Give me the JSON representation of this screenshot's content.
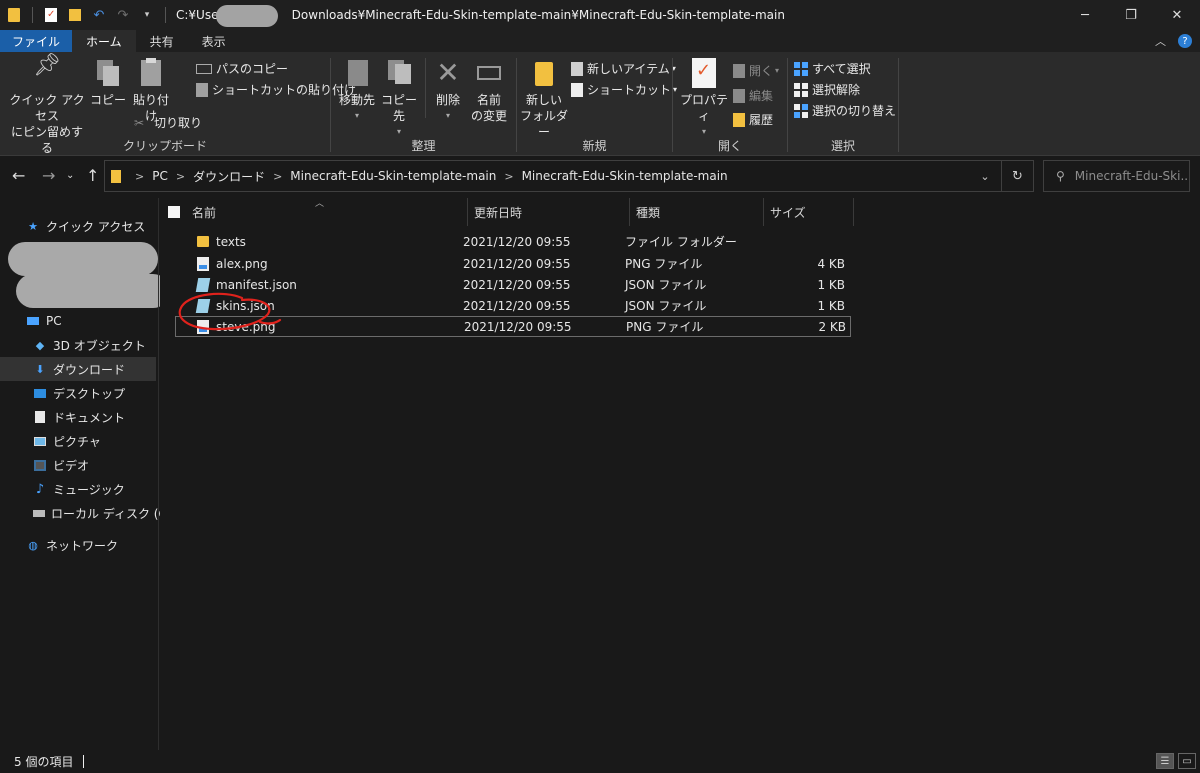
{
  "window": {
    "title_path_prefix": "C:¥Users",
    "title_path_suffix": "Downloads¥Minecraft-Edu-Skin-template-main¥Minecraft-Edu-Skin-template-main",
    "controls": {
      "minimize": "─",
      "maximize": "❐",
      "close": "✕"
    }
  },
  "ribbon_tabs": [
    "ファイル",
    "ホーム",
    "共有",
    "表示"
  ],
  "ribbon_tabs_active": "ホーム",
  "ribbon": {
    "clipboard": {
      "pin_label": "クイック アクセス\nにピン留めする",
      "copy_label": "コピー",
      "paste_label": "貼り付け",
      "copy_path_label": "パスのコピー",
      "paste_shortcut_label": "ショートカットの貼り付け",
      "cut_label": "切り取り",
      "group_label": "クリップボード"
    },
    "organize": {
      "move_to_label": "移動先",
      "copy_to_label": "コピー先",
      "delete_label": "削除",
      "rename_label": "名前\nの変更",
      "group_label": "整理"
    },
    "new": {
      "new_folder_label": "新しい\nフォルダー",
      "new_item_label": "新しいアイテム",
      "shortcut_label": "ショートカット",
      "group_label": "新規"
    },
    "open": {
      "properties_label": "プロパティ",
      "open_label": "開く",
      "edit_label": "編集",
      "history_label": "履歴",
      "group_label": "開く"
    },
    "select": {
      "select_all_label": "すべて選択",
      "select_none_label": "選択解除",
      "invert_label": "選択の切り替え",
      "group_label": "選択"
    }
  },
  "address": {
    "crumbs": [
      "PC",
      "ダウンロード",
      "Minecraft-Edu-Skin-template-main",
      "Minecraft-Edu-Skin-template-main"
    ],
    "search_placeholder": "Minecraft-Edu-Ski..."
  },
  "nav": {
    "quick_access": "クイック アクセス",
    "pc": "PC",
    "items": [
      "3D オブジェクト",
      "ダウンロード",
      "デスクトップ",
      "ドキュメント",
      "ピクチャ",
      "ビデオ",
      "ミュージック",
      "ローカル ディスク (C:)"
    ],
    "network": "ネットワーク"
  },
  "columns": {
    "name": "名前",
    "modified": "更新日時",
    "type": "種類",
    "size": "サイズ"
  },
  "files": [
    {
      "name": "texts",
      "modified": "2021/12/20 09:55",
      "type": "ファイル フォルダー",
      "size": ""
    },
    {
      "name": "alex.png",
      "modified": "2021/12/20 09:55",
      "type": "PNG ファイル",
      "size": "4 KB"
    },
    {
      "name": "manifest.json",
      "modified": "2021/12/20 09:55",
      "type": "JSON ファイル",
      "size": "1 KB"
    },
    {
      "name": "skins.json",
      "modified": "2021/12/20 09:55",
      "type": "JSON ファイル",
      "size": "1 KB"
    },
    {
      "name": "steve.png",
      "modified": "2021/12/20 09:55",
      "type": "PNG ファイル",
      "size": "2 KB"
    }
  ],
  "status": {
    "item_count": "5 個の項目"
  },
  "colors": {
    "file_tab": "#1b5fa8",
    "annotation_circle": "#e0221c",
    "folder": "#f2c040"
  }
}
